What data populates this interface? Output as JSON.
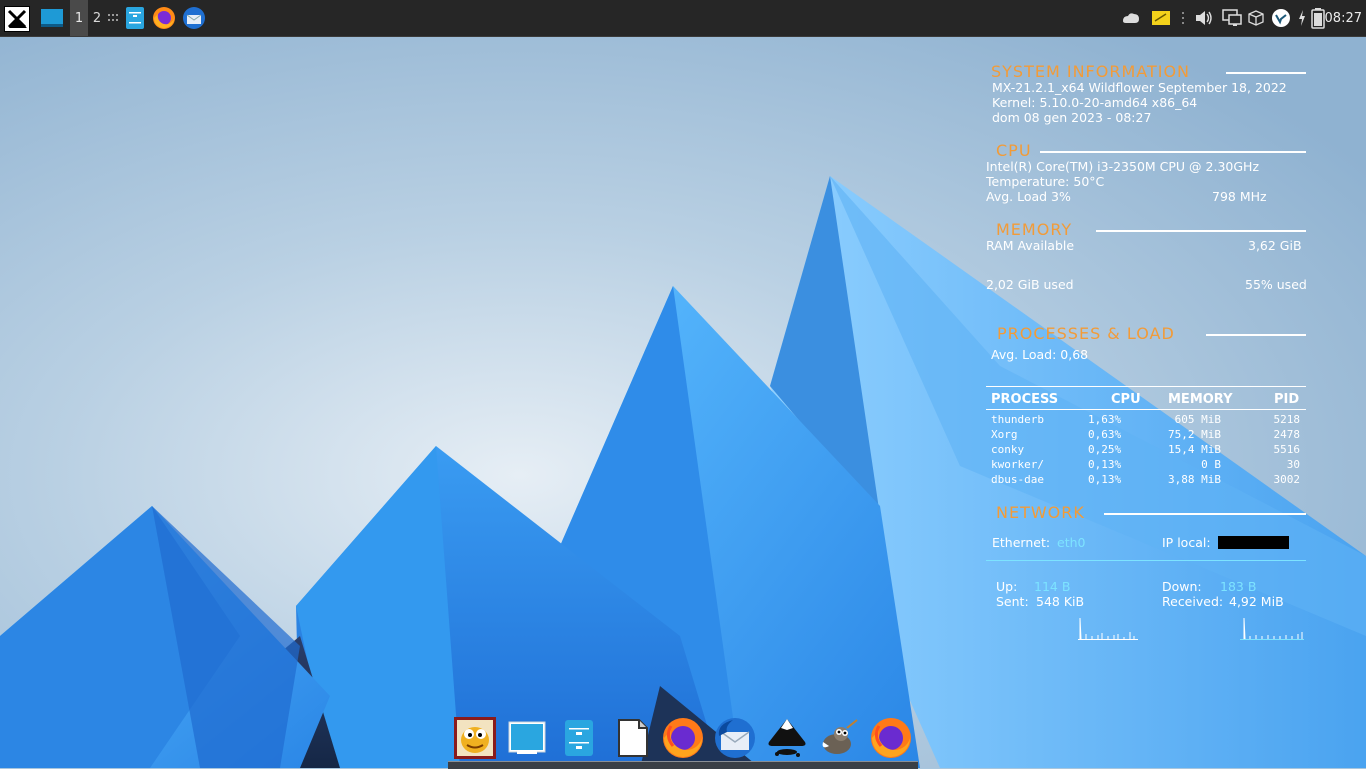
{
  "top_panel": {
    "workspaces": [
      "1",
      "2"
    ],
    "clock": "08:27"
  },
  "conky": {
    "system": {
      "heading": "SYSTEM INFORMATION",
      "distro": "MX-21.2.1_x64 Wildflower September 18, 2022",
      "kernel": "Kernel: 5.10.0-20-amd64 x86_64",
      "datetime": "dom 08 gen 2023 - 08:27"
    },
    "cpu": {
      "heading": "CPU",
      "model": "Intel(R) Core(TM) i3-2350M CPU @ 2.30GHz",
      "temperature": "Temperature:  50°C",
      "avg_load": "Avg. Load 3%",
      "freq": "798 MHz"
    },
    "memory": {
      "heading": "MEMORY",
      "ram_label": "RAM Available",
      "ram_value": "3,62 GiB",
      "used": "2,02 GiB used",
      "percent": "55% used"
    },
    "processes": {
      "heading": "PROCESSES & LOAD",
      "avg_load": "Avg. Load: 0,68",
      "columns": [
        "PROCESS",
        "CPU",
        "MEMORY",
        "PID"
      ],
      "rows": [
        {
          "name": "thunderb",
          "cpu": "1,63%",
          "mem": "605 MiB",
          "pid": "5218"
        },
        {
          "name": "Xorg",
          "cpu": "0,63%",
          "mem": "75,2 MiB",
          "pid": "2478"
        },
        {
          "name": "conky",
          "cpu": "0,25%",
          "mem": "15,4 MiB",
          "pid": "5516"
        },
        {
          "name": "kworker/",
          "cpu": "0,13%",
          "mem": "0 B",
          "pid": "30"
        },
        {
          "name": "dbus-dae",
          "cpu": "0,13%",
          "mem": "3,88 MiB",
          "pid": "3002"
        }
      ]
    },
    "network": {
      "heading": "NETWORK",
      "ethernet_label": "Ethernet:",
      "ethernet_value": "eth0",
      "ip_label": "IP local:",
      "up_label": "Up:",
      "up_value": "114 B",
      "sent_label": "Sent:",
      "sent_value": "548 KiB",
      "down_label": "Down:",
      "down_value": "183 B",
      "received_label": "Received:",
      "received_value": "4,92 MiB"
    }
  },
  "dock": {
    "icons": [
      "screenshot-app-icon",
      "desktop-icon",
      "file-manager-icon",
      "text-editor-icon",
      "firefox-icon",
      "thunderbird-icon",
      "inkscape-icon",
      "gimp-icon",
      "firefox-icon"
    ]
  },
  "colors": {
    "panel_bg": "#262626",
    "conky_heading": "#f29b38",
    "conky_accent": "#7de3ff"
  }
}
